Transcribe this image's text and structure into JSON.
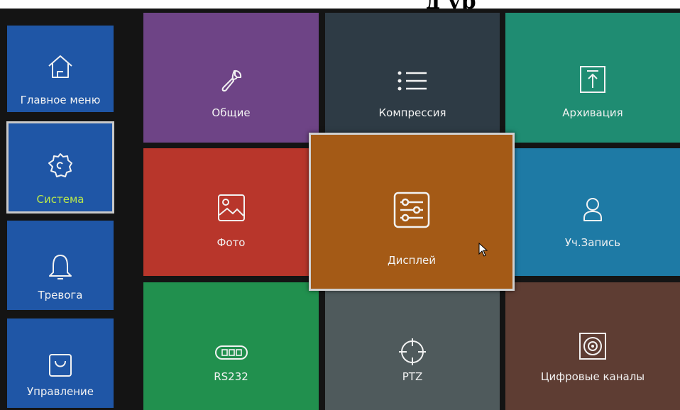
{
  "header": {
    "title_fragment": "д        ур"
  },
  "colors": {
    "side_tiles": "#1f56a6",
    "general": "#6e4486",
    "compression": "#2e3b45",
    "archive": "#1f8c72",
    "photo": "#b8362b",
    "display": "#a45a16",
    "recording": "#1e7aa5",
    "rs232": "#21904e",
    "ptz": "#4f5a5c",
    "digital_channels": "#5e3d33",
    "selected_label": "#b9e84a"
  },
  "sidebar": {
    "items": [
      {
        "label": "Главное меню",
        "icon": "home-icon"
      },
      {
        "label": "Система",
        "icon": "gear-icon",
        "selected": true
      },
      {
        "label": "Тревога",
        "icon": "bell-icon"
      },
      {
        "label": "Управление",
        "icon": "bag-icon"
      }
    ]
  },
  "tiles": {
    "general": {
      "label": "Общие",
      "icon": "wrench-icon"
    },
    "compression": {
      "label": "Компрессия",
      "icon": "list-icon"
    },
    "archive": {
      "label": "Архивация",
      "icon": "upload-icon"
    },
    "photo": {
      "label": "Фото",
      "icon": "image-icon"
    },
    "display": {
      "label": "Дисплей",
      "icon": "sliders-icon",
      "focused": true
    },
    "recording": {
      "label": "Уч.Запись",
      "icon": "user-icon"
    },
    "rs232": {
      "label": "RS232",
      "icon": "serial-port-icon"
    },
    "ptz": {
      "label": "PTZ",
      "icon": "crosshair-icon"
    },
    "digital_channels": {
      "label": "Цифровые каналы",
      "icon": "speaker-icon"
    }
  }
}
